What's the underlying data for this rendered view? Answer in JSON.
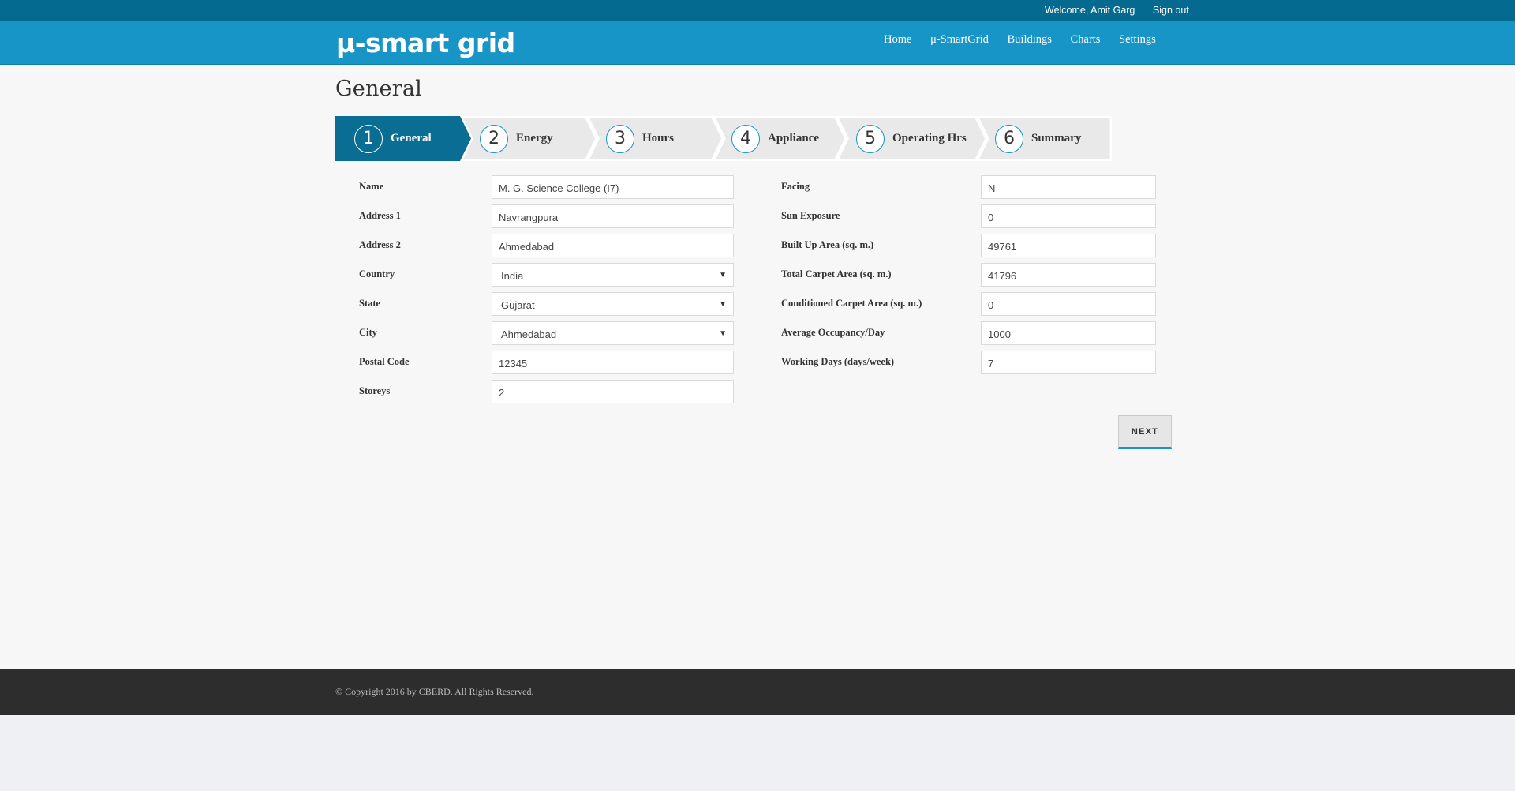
{
  "topbar": {
    "welcome": "Welcome, Amit Garg",
    "signout": "Sign out"
  },
  "brand": {
    "logo": "μ-smart grid"
  },
  "nav": [
    "Home",
    "μ-SmartGrid",
    "Buildings",
    "Charts",
    "Settings"
  ],
  "page": {
    "title": "General"
  },
  "wizard": {
    "steps": [
      {
        "num": "1",
        "label": "General"
      },
      {
        "num": "2",
        "label": "Energy"
      },
      {
        "num": "3",
        "label": "Hours"
      },
      {
        "num": "4",
        "label": "Appliance"
      },
      {
        "num": "5",
        "label": "Operating Hrs"
      },
      {
        "num": "6",
        "label": "Summary"
      }
    ]
  },
  "form": {
    "left": [
      {
        "label": "Name",
        "value": "M. G. Science College (I7)",
        "type": "text"
      },
      {
        "label": "Address 1",
        "value": "Navrangpura",
        "type": "text"
      },
      {
        "label": "Address 2",
        "value": "Ahmedabad",
        "type": "text"
      },
      {
        "label": "Country",
        "value": "India",
        "type": "select"
      },
      {
        "label": "State",
        "value": "Gujarat",
        "type": "select"
      },
      {
        "label": "City",
        "value": "Ahmedabad",
        "type": "select"
      },
      {
        "label": "Postal Code",
        "value": "12345",
        "type": "text"
      },
      {
        "label": "Storeys",
        "value": "2",
        "type": "text"
      }
    ],
    "right": [
      {
        "label": "Facing",
        "value": "N"
      },
      {
        "label": "Sun Exposure",
        "value": "0"
      },
      {
        "label": "Built Up Area (sq. m.)",
        "value": "49761"
      },
      {
        "label": "Total Carpet Area (sq. m.)",
        "value": "41796"
      },
      {
        "label": "Conditioned Carpet Area (sq. m.)",
        "value": "0"
      },
      {
        "label": "Average Occupancy/Day",
        "value": "1000"
      },
      {
        "label": "Working Days (days/week)",
        "value": "7"
      }
    ]
  },
  "actions": {
    "next": "NEXT"
  },
  "footer": {
    "copyright": "© Copyright 2016 by CBERD. All Rights Reserved."
  },
  "colors": {
    "topbar": "#056a8f",
    "navbar": "#1795c6",
    "active_step": "#0a6d93",
    "footer": "#2d2d2d"
  }
}
